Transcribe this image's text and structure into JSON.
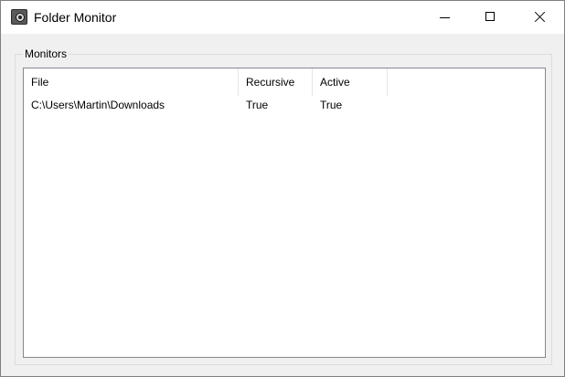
{
  "window": {
    "title": "Folder Monitor",
    "icon": "camera-eye-icon"
  },
  "caption_buttons": {
    "minimize": "minimize-icon",
    "maximize": "maximize-icon",
    "close": "close-icon"
  },
  "monitors": {
    "group_label": "Monitors",
    "columns": [
      "File",
      "Recursive",
      "Active"
    ],
    "rows": [
      {
        "file": "C:\\Users\\Martin\\Downloads",
        "recursive": "True",
        "active": "True"
      }
    ]
  }
}
